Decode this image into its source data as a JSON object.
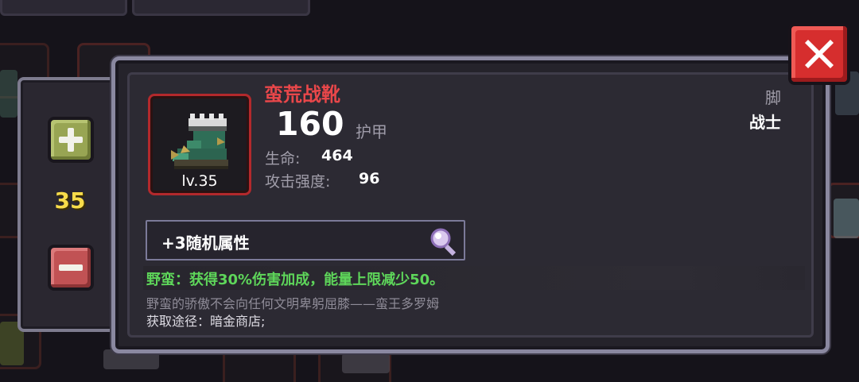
{
  "quantity_panel": {
    "quantity": "35",
    "plus_icon": "plus-icon",
    "minus_icon": "minus-icon"
  },
  "item": {
    "name": "蛮荒战靴",
    "level_badge": "lv.35",
    "armor_value": "160",
    "armor_label": "护甲",
    "stats": [
      {
        "label": "生命:",
        "value": "464"
      },
      {
        "label": "攻击强度:",
        "value": "96"
      }
    ],
    "slot": "脚",
    "class": "战士",
    "random_attributes": "+3随机属性",
    "effect": "野蛮：获得30%伤害加成，能量上限减少50。",
    "lore": "野蛮的骄傲不会向任何文明卑躬屈膝——蛮王多罗姆",
    "source": "获取途径：暗金商店;"
  },
  "icons": {
    "close": "close-icon",
    "search": "magnifier-icon",
    "item": "boots-icon"
  },
  "colors": {
    "item_name": "#e9474a",
    "effect": "#5ed65a",
    "quantity": "#f7dc4a",
    "rarity_border": "#b3292c",
    "close_button": "#d62e2e"
  }
}
